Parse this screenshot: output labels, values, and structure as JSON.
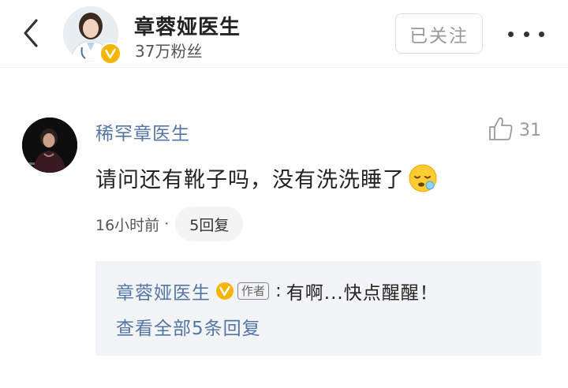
{
  "header": {
    "back_icon": "chevron-left-icon",
    "doctor_name": "章蓉娅医生",
    "fans": "37万粉丝",
    "follow_label": "已关注",
    "more_icon": "more-dots-icon",
    "verified_icon": "verified-v-icon"
  },
  "comment": {
    "author": "稀罕章医生",
    "like_count": "31",
    "like_icon": "thumbs-up-icon",
    "text": "请问还有靴子吗，没有洗洗睡了",
    "emoji": "sleepy-face-emoji",
    "time": "16小时前",
    "separator": "·",
    "reply_count_label": "5回复"
  },
  "reply_preview": {
    "author": "章蓉娅医生",
    "author_tag": "作者",
    "colon": ":",
    "text": "有啊...快点醒醒！",
    "view_all": "查看全部5条回复"
  },
  "colors": {
    "link_blue": "#5476a6",
    "verified_gold": "#f5b400",
    "reply_bg": "#f3f4f6"
  }
}
